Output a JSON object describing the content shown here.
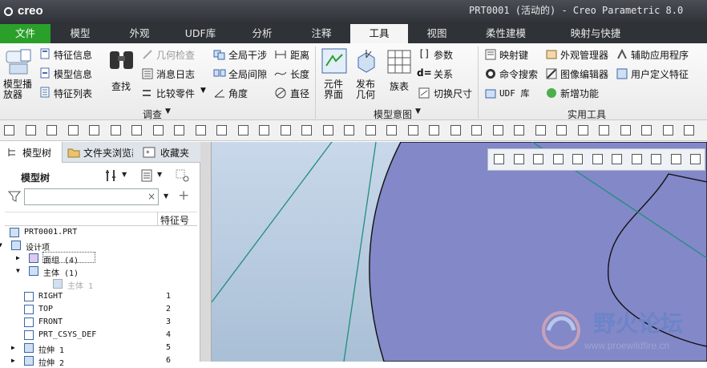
{
  "app": {
    "logo": "creo",
    "title": "PRT0001 (活动的) - Creo Parametric 8.0"
  },
  "tabs": [
    "文件",
    "模型",
    "外观",
    "UDF库",
    "分析",
    "注释",
    "工具",
    "视图",
    "柔性建模",
    "映射与快捷"
  ],
  "ribbon": {
    "model_player": "模型播放器",
    "feature_info": "特征信息",
    "model_info": "模型信息",
    "feature_list": "特征列表",
    "find": "查找",
    "geometry_check": "几何检查",
    "message_log": "消息日志",
    "compare_parts": "比较零件",
    "global_interference": "全局干涉",
    "global_clearance": "全局间隙",
    "angle": "角度",
    "distance": "距离",
    "length": "长度",
    "diameter": "直径",
    "group_investigate": "调查",
    "component_interface": "元件界面",
    "publish_geometry": "发布几何",
    "family_table": "族表",
    "parameters": "参数",
    "relations": "关系",
    "switch_dims": "切换尺寸",
    "group_model_intent": "模型意图",
    "mapkeys": "映射键",
    "appearance_manager": "外观管理器",
    "aux_apps": "辅助应用程序",
    "command_search": "命令搜索",
    "image_editor": "图像编辑器",
    "user_features": "用户定义特征",
    "udf_lib": "UDF 库",
    "new_features": "新增功能",
    "group_utilities": "实用工具"
  },
  "panel": {
    "tab_model_tree": "模型树",
    "tab_folder": "文件夹浏览器",
    "tab_favorites": "收藏夹",
    "header": "模型树",
    "col_feature_no": "特征号",
    "search_placeholder": ""
  },
  "tree": [
    {
      "label": "PRT0001.PRT",
      "num": ""
    },
    {
      "label": "设计项",
      "num": ""
    },
    {
      "label": "面组 (4)",
      "num": ""
    },
    {
      "label": "主体 (1)",
      "num": ""
    },
    {
      "label": "主体 1",
      "num": ""
    },
    {
      "label": "RIGHT",
      "num": "1"
    },
    {
      "label": "TOP",
      "num": "2"
    },
    {
      "label": "FRONT",
      "num": "3"
    },
    {
      "label": "PRT_CSYS_DEF",
      "num": "4"
    },
    {
      "label": "拉伸 1",
      "num": "5"
    },
    {
      "label": "拉伸 2",
      "num": "6"
    }
  ],
  "watermark": {
    "title": "野火论坛",
    "url": "www.proewildfire.cn"
  },
  "colors": {
    "accent": "#2aa02a",
    "titlebar": "#2e3136",
    "shape_fill": "#8288c8",
    "datum_line": "#1f8f7a"
  }
}
